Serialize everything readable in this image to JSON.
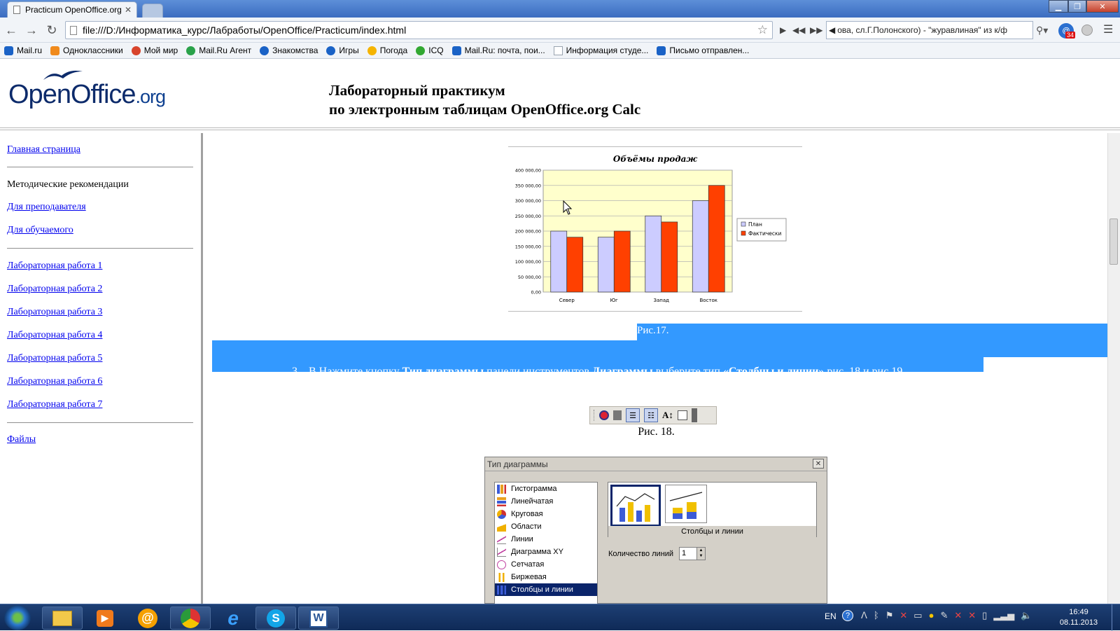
{
  "browser": {
    "tab_title": "Practicum OpenOffice.org",
    "url": "file:///D:/Информатика_курс/Лабработы/OpenOffice/Practicum/index.html",
    "media_text": "ова, сл.Г.Полонского) - \"журавлиная\" из к/ф",
    "badge_count": "34"
  },
  "bookmarks": [
    {
      "label": "Mail.ru",
      "color": "#1a62c6"
    },
    {
      "label": "Одноклассники",
      "color": "#f08a1c"
    },
    {
      "label": "Мой мир",
      "color": "#d8442c"
    },
    {
      "label": "Mail.Ru Агент",
      "color": "#2aa24a"
    },
    {
      "label": "Знакомства",
      "color": "#1a62c6"
    },
    {
      "label": "Игры",
      "color": "#1a62c6"
    },
    {
      "label": "Погода",
      "color": "#f5b400"
    },
    {
      "label": "ICQ",
      "color": "#32a832"
    },
    {
      "label": "Mail.Ru: почта, пои...",
      "color": "#1a62c6"
    },
    {
      "label": "Информация студе...",
      "color": "#9aa4b0"
    },
    {
      "label": "Письмо отправлен...",
      "color": "#1a62c6"
    }
  ],
  "header": {
    "logo_main": "OpenOffice",
    "logo_suffix": ".org",
    "title_line1": "Лабораторный практикум",
    "title_line2": "по электронным таблицам OpenOffice.org Calc"
  },
  "sidebar": {
    "home": "Главная страница",
    "method": "Методические рекомендации",
    "teacher": "Для преподавателя",
    "student": "Для обучаемого",
    "labs": [
      "Лабораторная работа 1",
      "Лабораторная работа 2",
      "Лабораторная работа 3",
      "Лабораторная работа 4",
      "Лабораторная работа 5",
      "Лабораторная работа 6",
      "Лабораторная работа 7"
    ],
    "files": "Файлы"
  },
  "content": {
    "fig17": "Рис.17.",
    "step_num": "3.",
    "step_t1": "В Нажмите кнопку ",
    "step_b1": "Тип диаграммы",
    "step_t2": " панели инструментов ",
    "step_b2": "Диаграммы",
    "step_t3": " выберите тип ",
    "step_b3": "«Столбцы и линии»",
    "step_t4": " рис. 18 и рис 19.",
    "fig18": "Рис. 18."
  },
  "chart_data": {
    "type": "bar",
    "title": "Объёмы продаж",
    "categories": [
      "Север",
      "Юг",
      "Запад",
      "Восток"
    ],
    "series": [
      {
        "name": "План",
        "color": "#ccccff",
        "values": [
          200000,
          180000,
          250000,
          300000
        ]
      },
      {
        "name": "Фактически",
        "color": "#ff4000",
        "values": [
          180000,
          200000,
          230000,
          350000
        ]
      }
    ],
    "yticks": [
      "0,00",
      "50 000,00",
      "100 000,00",
      "150 000,00",
      "200 000,00",
      "250 000,00",
      "300 000,00",
      "350 000,00",
      "400 000,00"
    ],
    "ylim": [
      0,
      400000
    ],
    "grid": true,
    "legend": "right"
  },
  "dialog": {
    "title": "Тип диаграммы",
    "types": [
      {
        "label": "Гистограмма",
        "color": "#3b5bd6"
      },
      {
        "label": "Линейчатая",
        "color": "#e8a020"
      },
      {
        "label": "Круговая",
        "color": "#d03030"
      },
      {
        "label": "Области",
        "color": "#f0b000"
      },
      {
        "label": "Линии",
        "color": "#c040a0"
      },
      {
        "label": "Диаграмма XY",
        "color": "#c040a0"
      },
      {
        "label": "Сетчатая",
        "color": "#c040a0"
      },
      {
        "label": "Биржевая",
        "color": "#f0b000"
      },
      {
        "label": "Столбцы и линии",
        "color": "#3b5bd6"
      }
    ],
    "selected_label": "Столбцы и линии",
    "lines_label": "Количество линий",
    "lines_value": "1"
  },
  "taskbar": {
    "lang": "EN",
    "time": "16:49",
    "date": "08.11.2013"
  }
}
